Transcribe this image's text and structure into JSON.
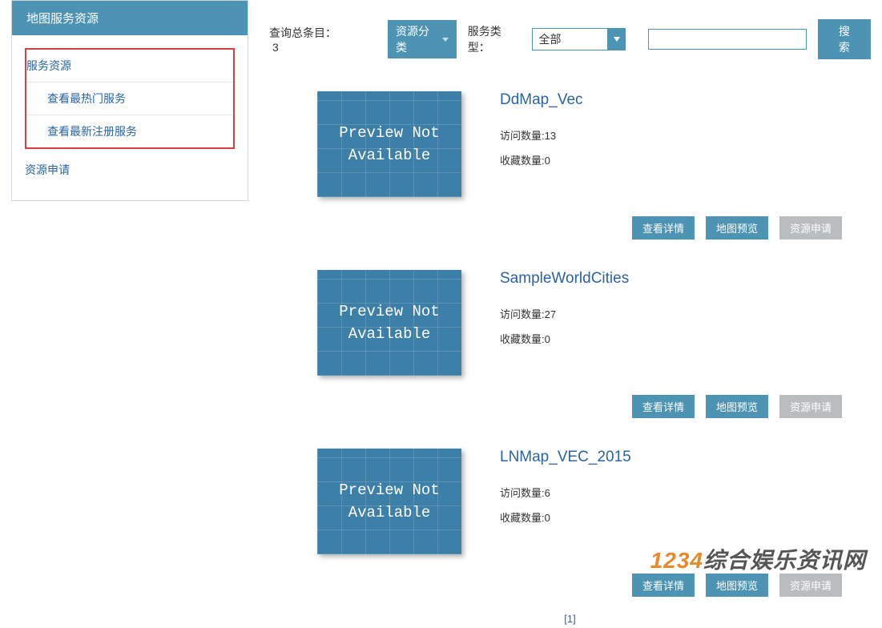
{
  "sidebar": {
    "title": "地图服务资源",
    "group1_label": "服务资源",
    "items": [
      {
        "label": "查看最热门服务"
      },
      {
        "label": "查看最新注册服务"
      }
    ],
    "group2_label": "资源申请"
  },
  "filters": {
    "total_label": "查询总条目：",
    "total_count": "3",
    "category_label": "资源分类",
    "type_label": "服务类型：",
    "type_value": "全部",
    "search_placeholder": "",
    "search_btn": "搜索"
  },
  "thumb_text": {
    "line1": "Preview Not",
    "line2": "Available"
  },
  "results": [
    {
      "title": "DdMap_Vec",
      "visit_label": "访问数量:",
      "visit_count": "13",
      "fav_label": "收藏数量:",
      "fav_count": "0"
    },
    {
      "title": "SampleWorldCities",
      "visit_label": "访问数量:",
      "visit_count": "27",
      "fav_label": "收藏数量:",
      "fav_count": "0"
    },
    {
      "title": "LNMap_VEC_2015",
      "visit_label": "访问数量:",
      "visit_count": "6",
      "fav_label": "收藏数量:",
      "fav_count": "0"
    }
  ],
  "action_labels": {
    "detail": "查看详情",
    "preview": "地图预览",
    "apply": "资源申请"
  },
  "pagination": {
    "current": "[1]"
  },
  "watermark": {
    "num": "1234",
    "text": "综合娱乐资讯网"
  }
}
